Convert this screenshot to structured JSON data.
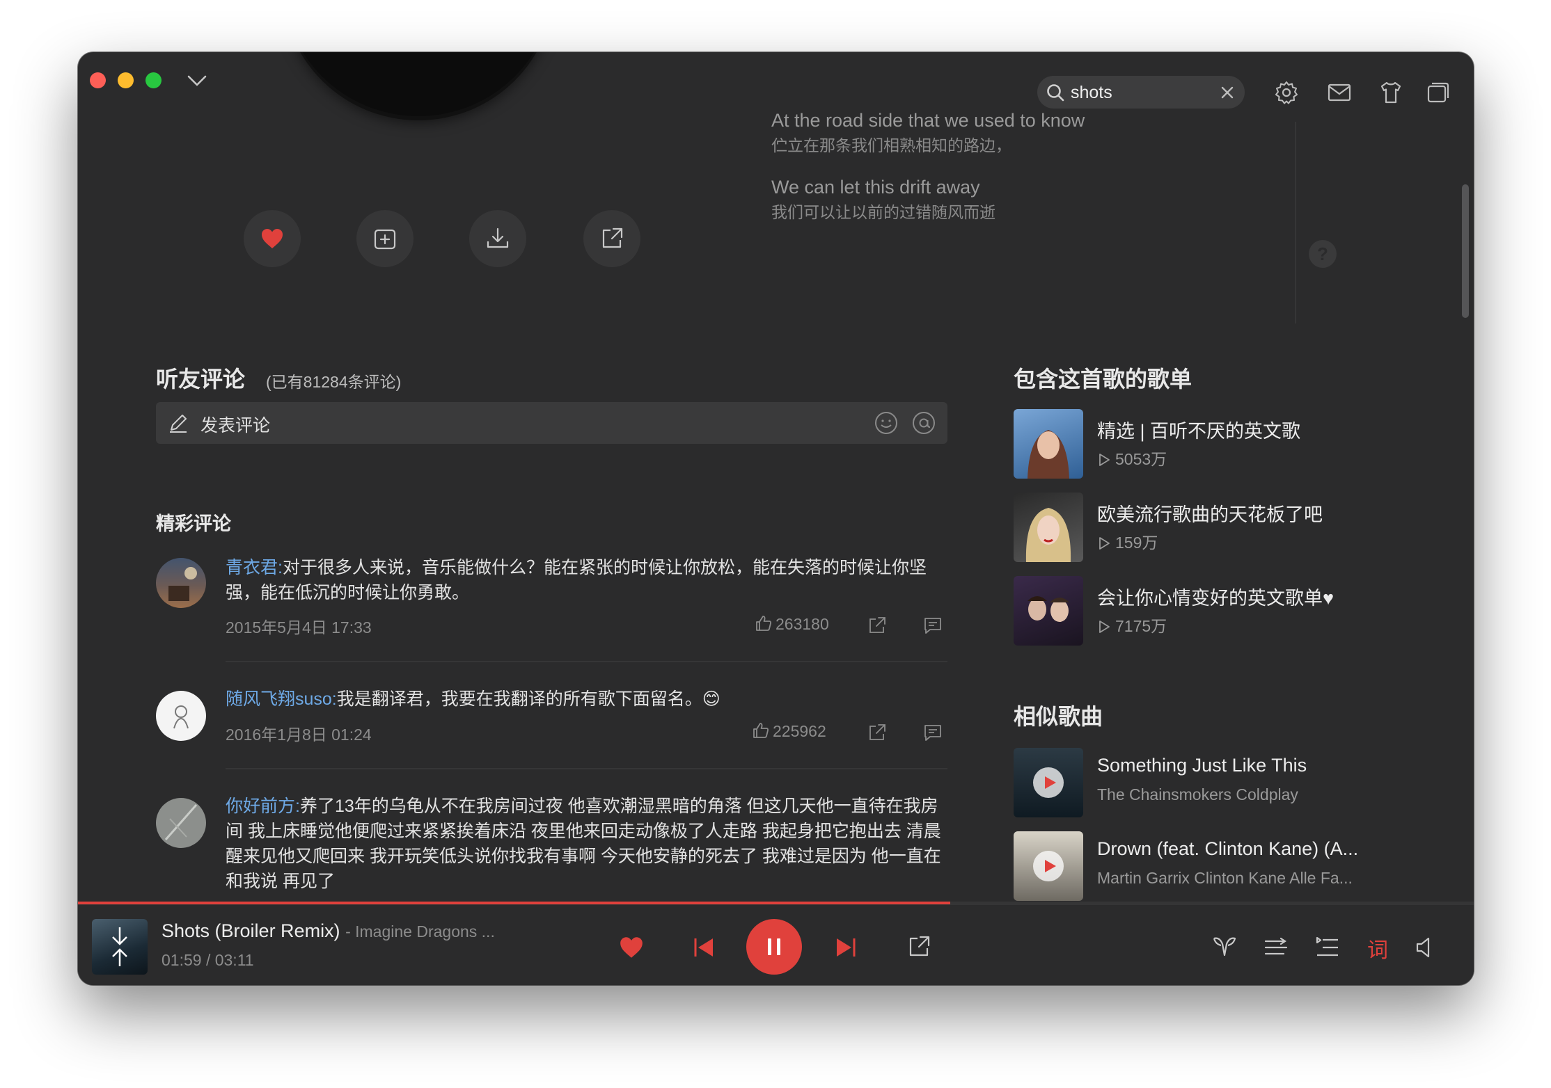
{
  "window": {
    "search": {
      "value": "shots",
      "placeholder": ""
    }
  },
  "lyrics": [
    {
      "en": "At the road side that we used to know",
      "cn": "伫立在那条我们相熟相知的路边，"
    },
    {
      "en": "We can let this drift away",
      "cn": "我们可以让以前的过错随风而逝"
    }
  ],
  "comments_section": {
    "title": "听友评论",
    "count_text": "(已有81284条评论)",
    "composer_placeholder": "发表评论",
    "featured_title": "精彩评论",
    "items": [
      {
        "user": "青衣君:",
        "text": "对于很多人来说，音乐能做什么？能在紧张的时候让你放松，能在失落的时候让你坚强，能在低沉的时候让你勇敢。",
        "time": "2015年5月4日 17:33",
        "likes": "263180"
      },
      {
        "user": "随风飞翔suso:",
        "text": "我是翻译君，我要在我翻译的所有歌下面留名。😊",
        "time": "2016年1月8日 01:24",
        "likes": "225962"
      },
      {
        "user": "你好前方:",
        "text": "养了13年的乌龟从不在我房间过夜 他喜欢潮湿黑暗的角落 但这几天他一直待在我房间 我上床睡觉他便爬过来紧紧挨着床沿 夜里他来回走动像极了人走路 我起身把它抱出去 清晨醒来见他又爬回来 我开玩笑低头说你找我有事啊 今天他安静的死去了 我难过是因为 他一直在和我说 再见了",
        "time": "",
        "likes": ""
      }
    ]
  },
  "playlists_section": {
    "title": "包含这首歌的歌单",
    "items": [
      {
        "name": "精选 | 百听不厌的英文歌",
        "plays": "5053万"
      },
      {
        "name": "欧美流行歌曲的天花板了吧",
        "plays": "159万"
      },
      {
        "name": "会让你心情变好的英文歌单♥",
        "plays": "7175万"
      }
    ]
  },
  "similar_section": {
    "title": "相似歌曲",
    "items": [
      {
        "name": "Something Just Like This",
        "artist": "The Chainsmokers Coldplay"
      },
      {
        "name": "Drown (feat. Clinton Kane) (A...",
        "artist": "Martin Garrix Clinton Kane Alle Fa..."
      }
    ]
  },
  "player": {
    "title": "Shots (Broiler Remix)",
    "artist": "- Imagine Dragons ...",
    "time_text": "01:59 /  03:11",
    "progress": 0.625,
    "lyric_label": "词",
    "accent": "#e0413c"
  },
  "colors": {
    "background": "#2b2b2c",
    "username": "#6ea9e6",
    "accent": "#e0413c"
  }
}
